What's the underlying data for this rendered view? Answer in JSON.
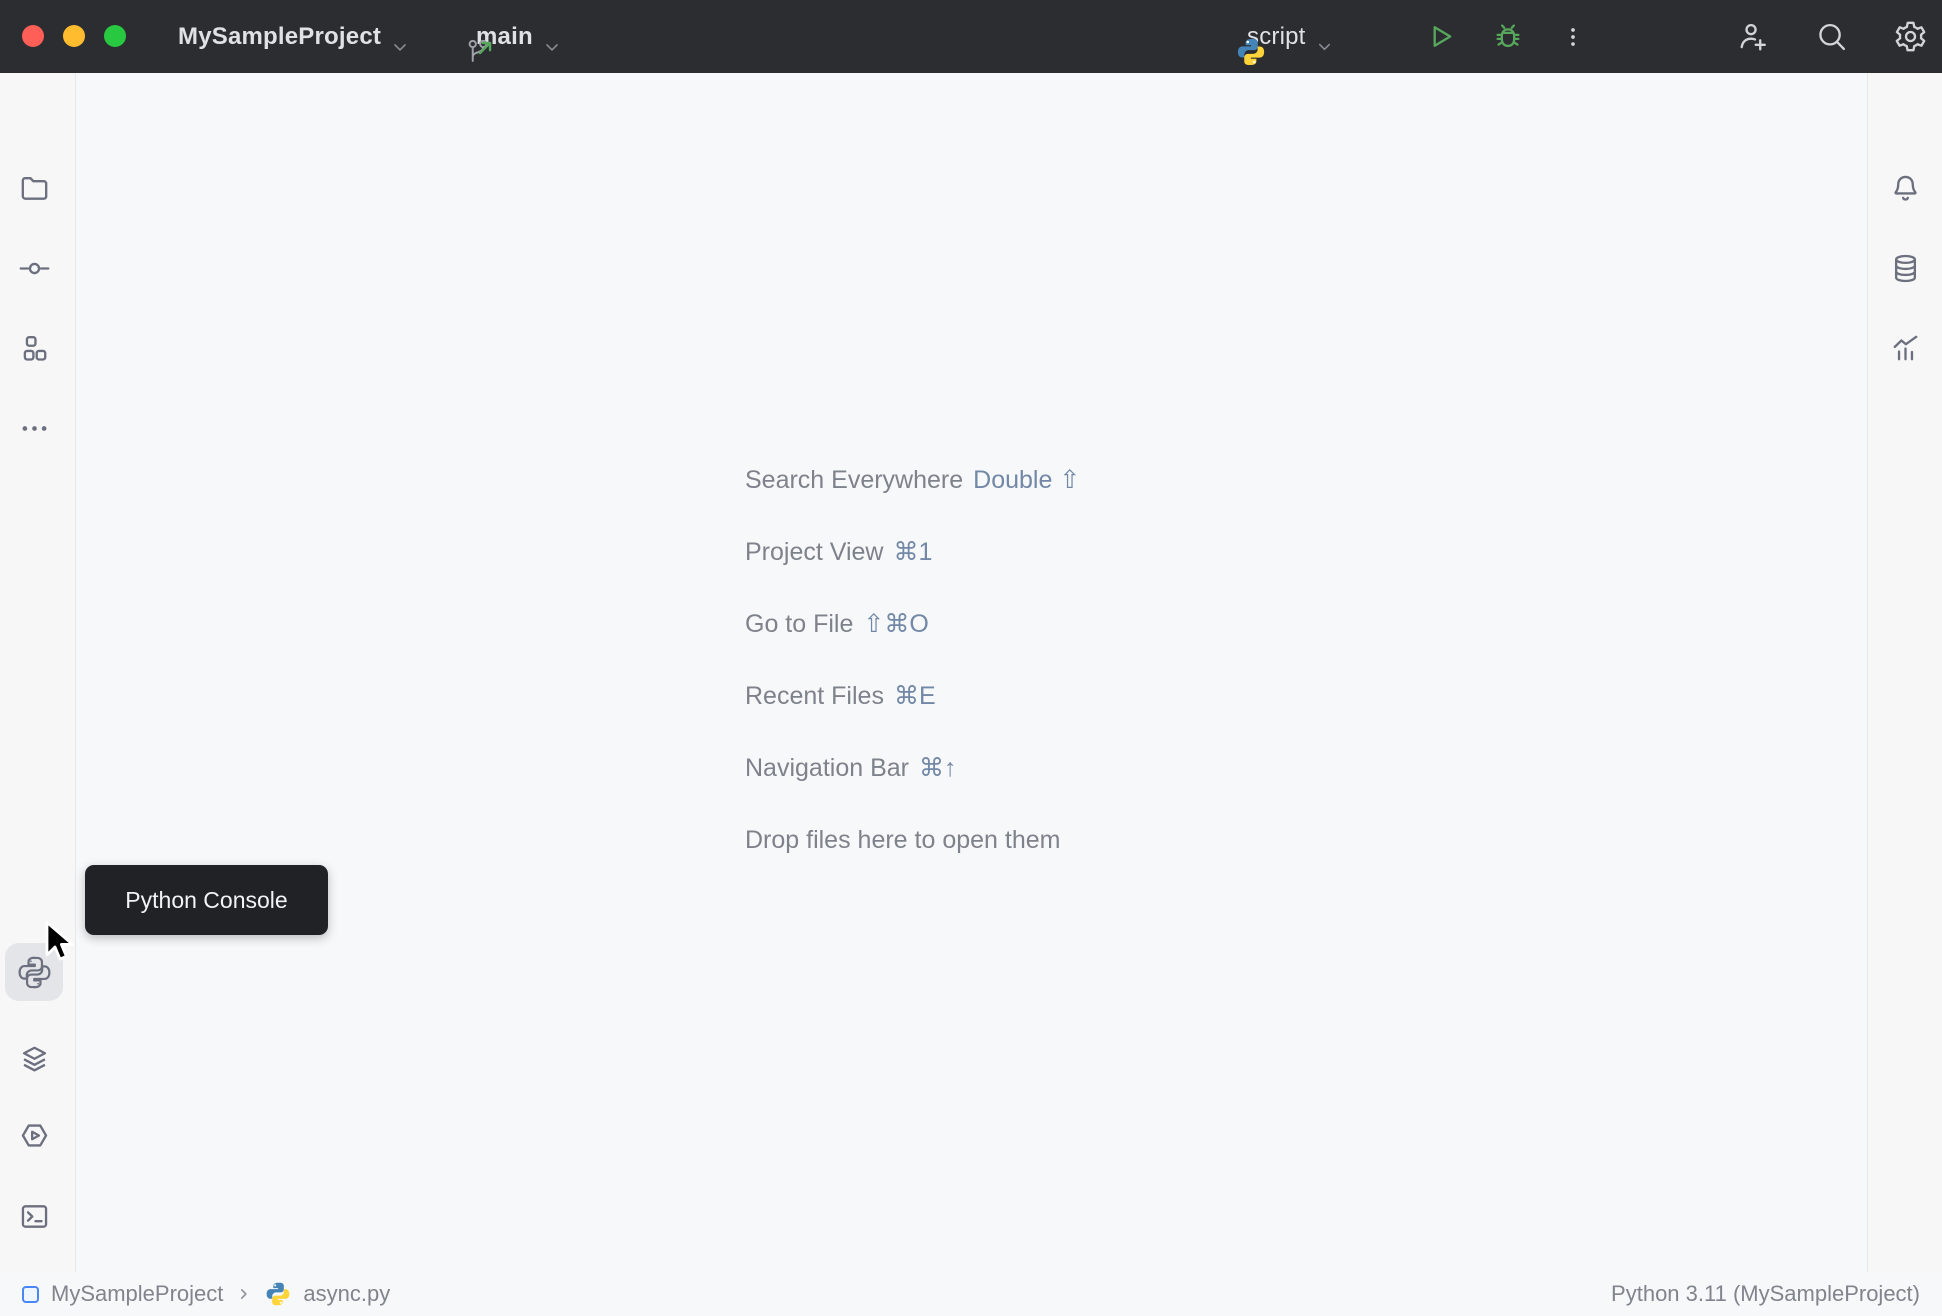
{
  "titlebar": {
    "project_name": "MySampleProject",
    "branch_name": "main",
    "run_config_name": "script"
  },
  "tooltip": {
    "text": "Python Console"
  },
  "shortcuts": [
    {
      "label": "Search Everywhere",
      "shortcut": "Double ⇧"
    },
    {
      "label": "Project View",
      "shortcut": "⌘1"
    },
    {
      "label": "Go to File",
      "shortcut": "⇧⌘O"
    },
    {
      "label": "Recent Files",
      "shortcut": "⌘E"
    },
    {
      "label": "Navigation Bar",
      "shortcut": "⌘↑"
    },
    {
      "label": "Drop files here to open them",
      "shortcut": ""
    }
  ],
  "statusbar": {
    "breadcrumb_project": "MySampleProject",
    "breadcrumb_file": "async.py",
    "interpreter": "Python 3.11 (MySampleProject)"
  },
  "icons": {
    "titlebar": [
      "git-branch-icon",
      "up-right-arrow-icon",
      "python-logo-icon",
      "run-icon",
      "debug-icon",
      "kebab-menu-icon",
      "add-user-icon",
      "search-icon",
      "gear-icon",
      "chevron-down-icon"
    ],
    "left_toolbar": [
      "folder-icon",
      "commit-icon",
      "structure-icon",
      "more-icon",
      "python-console-icon",
      "services-icon",
      "run-anything-icon",
      "terminal-icon",
      "git-icon"
    ],
    "right_toolbar": [
      "bell-icon",
      "database-icon",
      "chart-icon",
      "problems-icon"
    ],
    "statusbar": [
      "module-icon",
      "chevron-right-icon",
      "python-logo-icon"
    ]
  },
  "colors": {
    "titlebar_bg": "#2b2d30",
    "titlebar_text": "#dfe1e5",
    "titlebar_icon": "#9da1a8",
    "accent_green": "#57a85c",
    "traffic_red": "#ff5f57",
    "traffic_yellow": "#febc2e",
    "traffic_green": "#28c840",
    "main_bg": "#f7f8fa",
    "sidebar_bg": "#f7f7f8",
    "border": "#e6e8ec",
    "icon_gray": "#6c707e",
    "hover_bg": "#e4e5e9",
    "tooltip_bg": "#202226",
    "tooltip_text": "#f2f3f5",
    "hint_label": "#7e828b",
    "hint_shortcut": "#7288a6",
    "status_text": "#80848c",
    "python_blue": "#4584b6",
    "python_yellow": "#ffd43b",
    "breadcrumb_blue": "#4a87f5"
  }
}
